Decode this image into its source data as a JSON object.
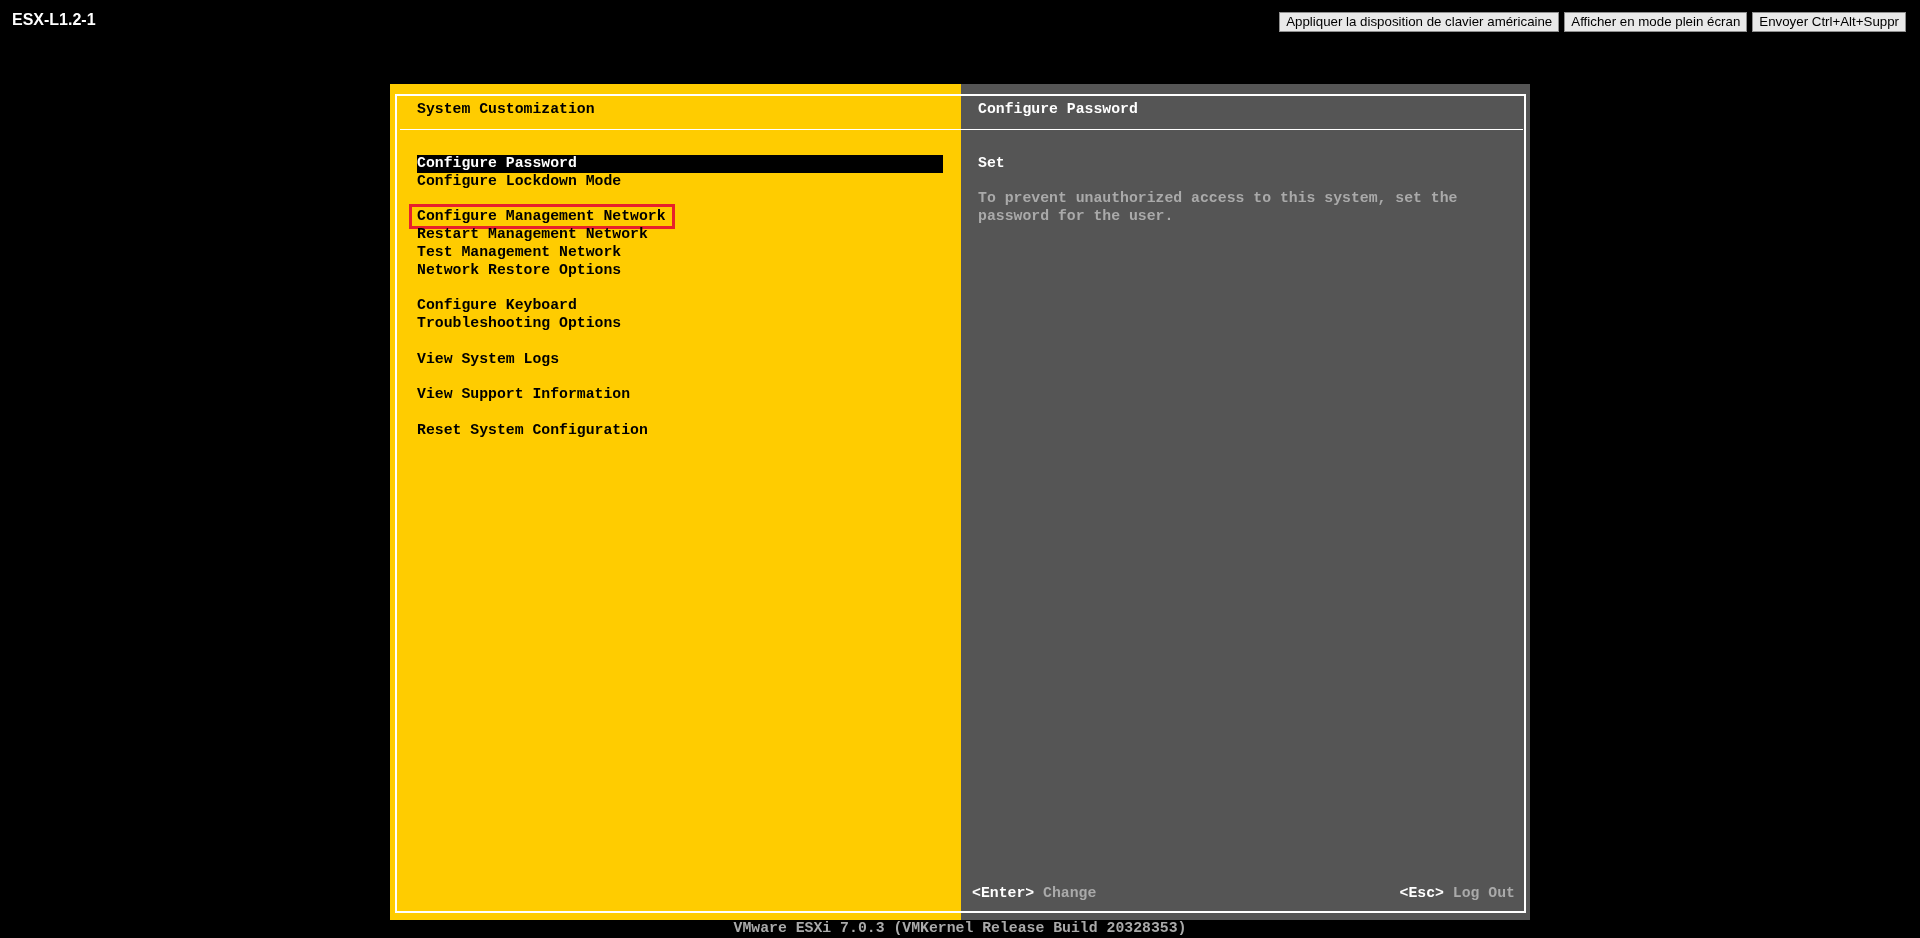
{
  "window": {
    "title": "ESX-L1.2-1"
  },
  "toolbar": {
    "buttons": [
      "Appliquer la disposition de clavier américaine",
      "Afficher en mode plein écran",
      "Envoyer Ctrl+Alt+Suppr"
    ]
  },
  "console": {
    "left_panel": {
      "title": "System Customization",
      "menu_groups": [
        {
          "items": [
            {
              "label": "Configure Password",
              "selected": true,
              "annotated": false
            },
            {
              "label": "Configure Lockdown Mode",
              "selected": false,
              "annotated": false
            }
          ]
        },
        {
          "items": [
            {
              "label": "Configure Management Network",
              "selected": false,
              "annotated": true
            },
            {
              "label": "Restart Management Network",
              "selected": false,
              "annotated": false
            },
            {
              "label": "Test Management Network",
              "selected": false,
              "annotated": false
            },
            {
              "label": "Network Restore Options",
              "selected": false,
              "annotated": false
            }
          ]
        },
        {
          "items": [
            {
              "label": "Configure Keyboard",
              "selected": false,
              "annotated": false
            },
            {
              "label": "Troubleshooting Options",
              "selected": false,
              "annotated": false
            }
          ]
        },
        {
          "items": [
            {
              "label": "View System Logs",
              "selected": false,
              "annotated": false
            }
          ]
        },
        {
          "items": [
            {
              "label": "View Support Information",
              "selected": false,
              "annotated": false
            }
          ]
        },
        {
          "items": [
            {
              "label": "Reset System Configuration",
              "selected": false,
              "annotated": false
            }
          ]
        }
      ]
    },
    "right_panel": {
      "title": "Configure Password",
      "status": "Set",
      "description": "To prevent unauthorized access to this system, set the password for the user.",
      "footer": [
        {
          "key": "<Enter>",
          "action": "Change"
        },
        {
          "key": "<Esc>",
          "action": "Log Out"
        }
      ]
    },
    "status_line": "VMware ESXi 7.0.3 (VMKernel Release Build 20328353)"
  }
}
